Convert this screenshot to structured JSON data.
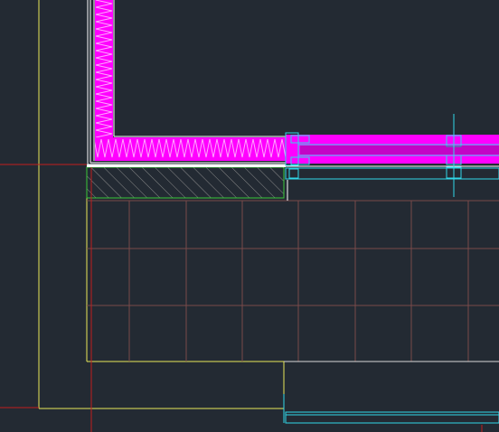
{
  "colors": {
    "background": "#232a33",
    "insulation": "#ff00ff",
    "insulation_zigzag": "#ffa8ff",
    "wall_outline": "#ffffff",
    "boundary_yellow": "#e8e85a",
    "crosshair_red": "#c01e1e",
    "tile_grid": "#7a4a4a",
    "hatch_green": "#38c838",
    "hatch_lines": "#8a8a8a",
    "window_cyan": "#30d8e8",
    "window_glass": "#101418"
  },
  "icons": {
    "crosshair": "crosshair-icon"
  }
}
